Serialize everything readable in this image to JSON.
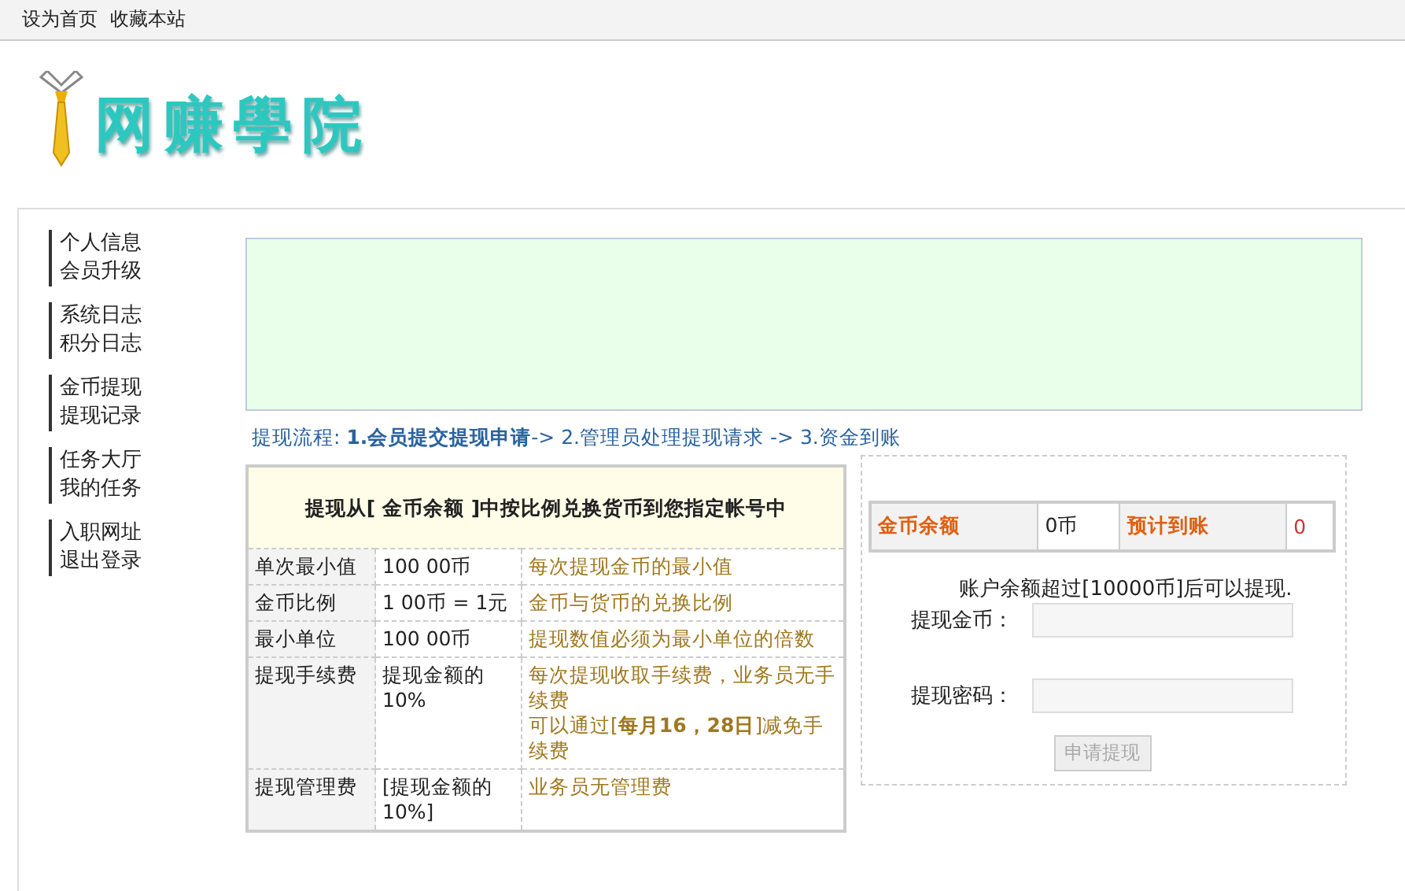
{
  "top_links": [
    "设为首页",
    "收藏本站"
  ],
  "logo": {
    "text": "网赚學院"
  },
  "sidebar": {
    "groups": [
      {
        "items": [
          {
            "label": "个人信息",
            "selected": false
          },
          {
            "label": "会员升级",
            "selected": false
          }
        ]
      },
      {
        "items": [
          {
            "label": "系统日志",
            "selected": false
          },
          {
            "label": "积分日志",
            "selected": false
          }
        ]
      },
      {
        "items": [
          {
            "label": "金币提现",
            "selected": false
          },
          {
            "label": "提现记录",
            "selected": false
          }
        ]
      },
      {
        "items": [
          {
            "label": "任务大厅",
            "selected": false
          },
          {
            "label": "我的任务",
            "selected": false
          }
        ]
      },
      {
        "items": [
          {
            "label": "入职网址",
            "selected": false
          },
          {
            "label": "退出登录",
            "selected": false
          }
        ]
      }
    ]
  },
  "process": "提现流程: **1.会员提交提现申请**-> 2.管理员处理提现请求 -> 3.资金到账",
  "rules": {
    "title": "提现从[ 金币余额 ]中按比例兑换货币到您指定帐号中",
    "rows": [
      {
        "label": "单次最小值",
        "value": "100 00币",
        "desc": [
          "每次提现金币的最小值"
        ]
      },
      {
        "label": "金币比例",
        "value": "1 00币 = 1元",
        "desc": [
          "金币与货币的兑换比例"
        ]
      },
      {
        "label": "最小单位",
        "value": "100 00币",
        "desc": [
          "提现数值必须为最小单位的倍数"
        ]
      },
      {
        "label": "提现手续费",
        "value": "提现金额的10%",
        "desc": [
          "每次提现收取手续费，业务员无手续费",
          "可以通过[**每月16，28日**]减免手续费"
        ]
      },
      {
        "label": "提现管理费",
        "value": "[提现金额的10%]",
        "desc": [
          "业务员无管理费"
        ]
      }
    ]
  },
  "balance": {
    "coin_label": "金币余额",
    "coin_value": "0币",
    "expected_label": "预计到账",
    "expected_value": "0"
  },
  "form": {
    "note": "账户余额超过[10000币]后可以提现.",
    "fields": [
      {
        "label": "提现金币："
      },
      {
        "label": "提现密码："
      }
    ],
    "submit": {
      "label": "申请提现",
      "disabled": true
    }
  }
}
